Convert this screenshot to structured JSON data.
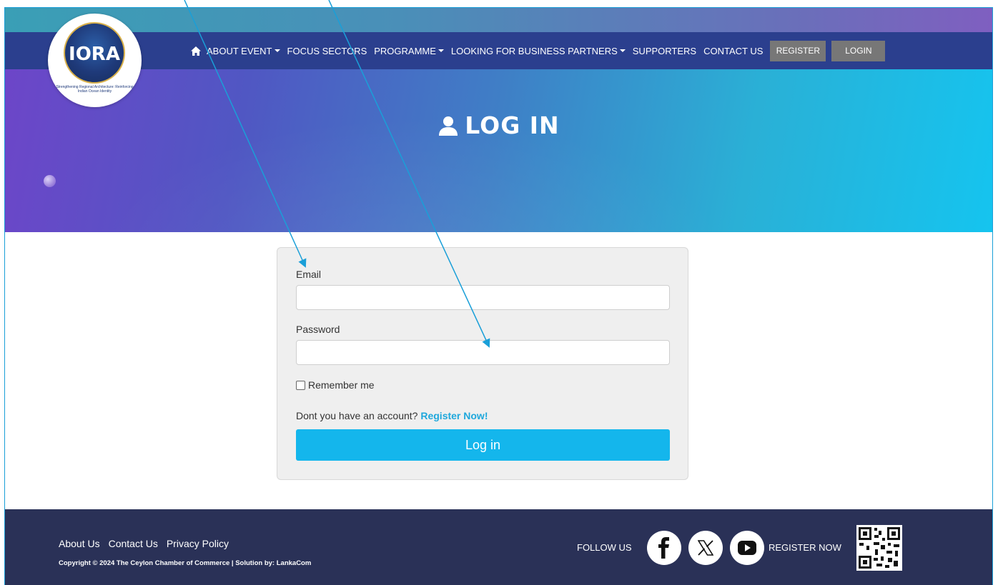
{
  "nav": {
    "items": [
      {
        "label": "ABOUT EVENT",
        "dropdown": true
      },
      {
        "label": "FOCUS SECTORS",
        "dropdown": false
      },
      {
        "label": "PROGRAMME",
        "dropdown": true
      },
      {
        "label": "LOOKING FOR BUSINESS PARTNERS",
        "dropdown": true
      },
      {
        "label": "SUPPORTERS",
        "dropdown": false
      },
      {
        "label": "CONTACT US",
        "dropdown": false
      }
    ],
    "register_label": "REGISTER",
    "login_label": "LOGIN"
  },
  "logo": {
    "letters": "IORA",
    "tagline": "Strengthening Regional Architecture: Reinforcing Indian Ocean Identity"
  },
  "hero": {
    "title": "LOG IN",
    "icon": "user-icon"
  },
  "form": {
    "email_label": "Email",
    "email_value": "",
    "password_label": "Password",
    "password_value": "",
    "remember_label": "Remember me",
    "remember_checked": false,
    "account_prompt": "Dont you have an account?",
    "account_link": "Register Now!",
    "submit_label": "Log in"
  },
  "footer": {
    "links": [
      "About Us",
      "Contact Us",
      "Privacy Policy"
    ],
    "copyright": "Copyright © 2024 The Ceylon Chamber of Commerce | Solution by: LankaCom",
    "follow_label": "FOLLOW US",
    "social": [
      "facebook-icon",
      "x-icon",
      "youtube-icon"
    ],
    "register_now_label": "REGISTER NOW"
  },
  "colors": {
    "nav_bg": "#2b3f8e",
    "accent": "#14b6ec",
    "footer_bg": "#2a3157",
    "annotation_arrow": "#1a9fd8"
  }
}
